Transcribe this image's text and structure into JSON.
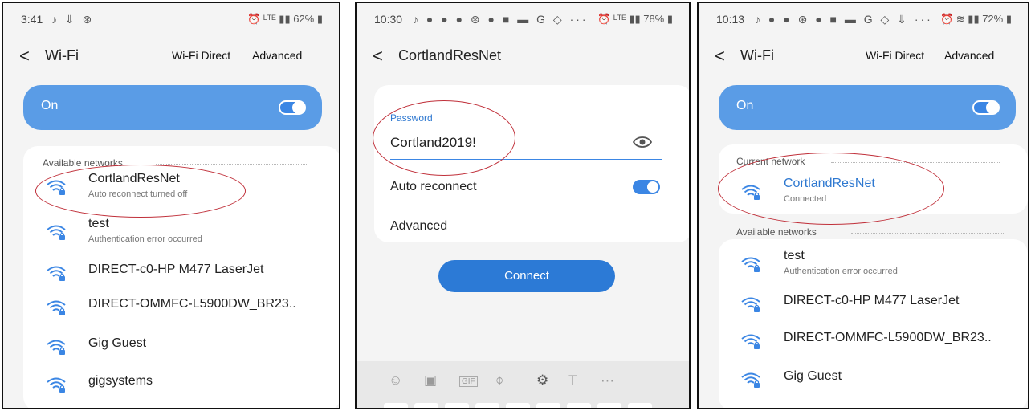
{
  "icons": {
    "music": "music-note-icon",
    "download": "download-icon",
    "sync": "sync-icon",
    "wifi": "wifi-lock-icon",
    "eye": "eye-icon",
    "back": "back-arrow-icon",
    "gear": "gear-icon",
    "mic": "mic-icon"
  },
  "colors": {
    "accent": "#2c7ad6",
    "on_bar": "#5a9ce6",
    "annotation": "#c0303a"
  },
  "panels": [
    {
      "status_time": "3:41",
      "status_icons": "♪ ⇓ ⊛",
      "status_right": "⏰ ᴸᵀᴱ ▮▮ 62% ▮",
      "back": "<",
      "title": "Wi-Fi",
      "wifi_direct": "Wi-Fi Direct",
      "advanced": "Advanced",
      "on_label": "On",
      "available_label": "Available networks",
      "networks": [
        {
          "name": "CortlandResNet",
          "sub": "Auto reconnect turned off"
        },
        {
          "name": "test",
          "sub": "Authentication error occurred"
        },
        {
          "name": "DIRECT-c0-HP M477 LaserJet",
          "sub": ""
        },
        {
          "name": "DIRECT-OMMFC-L5900DW_BR23..",
          "sub": ""
        },
        {
          "name": "Gig Guest",
          "sub": ""
        },
        {
          "name": "gigsystems",
          "sub": ""
        }
      ]
    },
    {
      "status_time": "10:30",
      "status_icons": "♪ ● ● ● ⊛ ● ■ ▬ G ◇ ···",
      "status_right": "⏰ ᴸᵀᴱ ▮▮ 78% ▮",
      "back": "<",
      "title": "CortlandResNet",
      "password_label": "Password",
      "password_value": "Cortland2019!",
      "auto_reconnect": "Auto reconnect",
      "advanced": "Advanced",
      "connect": "Connect",
      "keyboard_icons": [
        "☺",
        "▣",
        "GIF",
        "⌽",
        "⚙",
        "T",
        "···"
      ]
    },
    {
      "status_time": "10:13",
      "status_icons": "♪ ● ● ⊛ ● ■ ▬ G ◇ ⇓ ···",
      "status_right": "⏰ ≋ ▮▮ 72% ▮",
      "back": "<",
      "title": "Wi-Fi",
      "wifi_direct": "Wi-Fi Direct",
      "advanced": "Advanced",
      "on_label": "On",
      "current_label": "Current network",
      "current": {
        "name": "CortlandResNet",
        "sub": "Connected"
      },
      "available_label": "Available networks",
      "networks": [
        {
          "name": "test",
          "sub": "Authentication error occurred"
        },
        {
          "name": "DIRECT-c0-HP M477 LaserJet",
          "sub": ""
        },
        {
          "name": "DIRECT-OMMFC-L5900DW_BR23..",
          "sub": ""
        },
        {
          "name": "Gig Guest",
          "sub": ""
        }
      ]
    }
  ]
}
